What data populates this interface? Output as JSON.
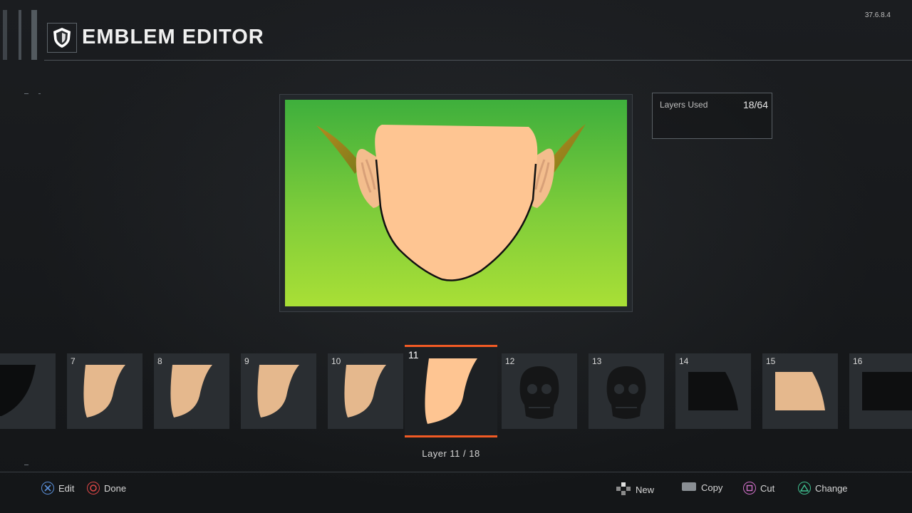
{
  "header": {
    "title": "EMBLEM EDITOR",
    "icon": "shield-icon",
    "version": "37.6.8.4"
  },
  "layers_used": {
    "label": "Layers Used",
    "value": "18/64"
  },
  "layers": [
    {
      "num": "",
      "shape": "corner-dark"
    },
    {
      "num": "7",
      "shape": "tooth"
    },
    {
      "num": "8",
      "shape": "tooth"
    },
    {
      "num": "9",
      "shape": "tooth"
    },
    {
      "num": "10",
      "shape": "tooth"
    },
    {
      "num": "11",
      "shape": "tooth",
      "selected": true
    },
    {
      "num": "12",
      "shape": "skull"
    },
    {
      "num": "13",
      "shape": "skull"
    },
    {
      "num": "14",
      "shape": "block-dark"
    },
    {
      "num": "15",
      "shape": "block-tan"
    },
    {
      "num": "16",
      "shape": "block-dark-partial"
    }
  ],
  "layer_caption": "Layer 11 / 18",
  "controls_left": [
    {
      "icon": "cross-button-icon",
      "label": "Edit"
    },
    {
      "icon": "circle-button-icon",
      "label": "Done"
    }
  ],
  "controls_right": [
    {
      "icon": "dpad-icon",
      "label": "New"
    },
    {
      "icon": "touchpad-icon",
      "label": "Copy"
    },
    {
      "icon": "square-button-icon",
      "label": "Cut"
    },
    {
      "icon": "triangle-button-icon",
      "label": "Change"
    }
  ],
  "colors": {
    "accent": "#f15a24",
    "skin": "#fec592",
    "canvas_top": "#3eaf3c",
    "canvas_bottom": "#a9df36"
  }
}
